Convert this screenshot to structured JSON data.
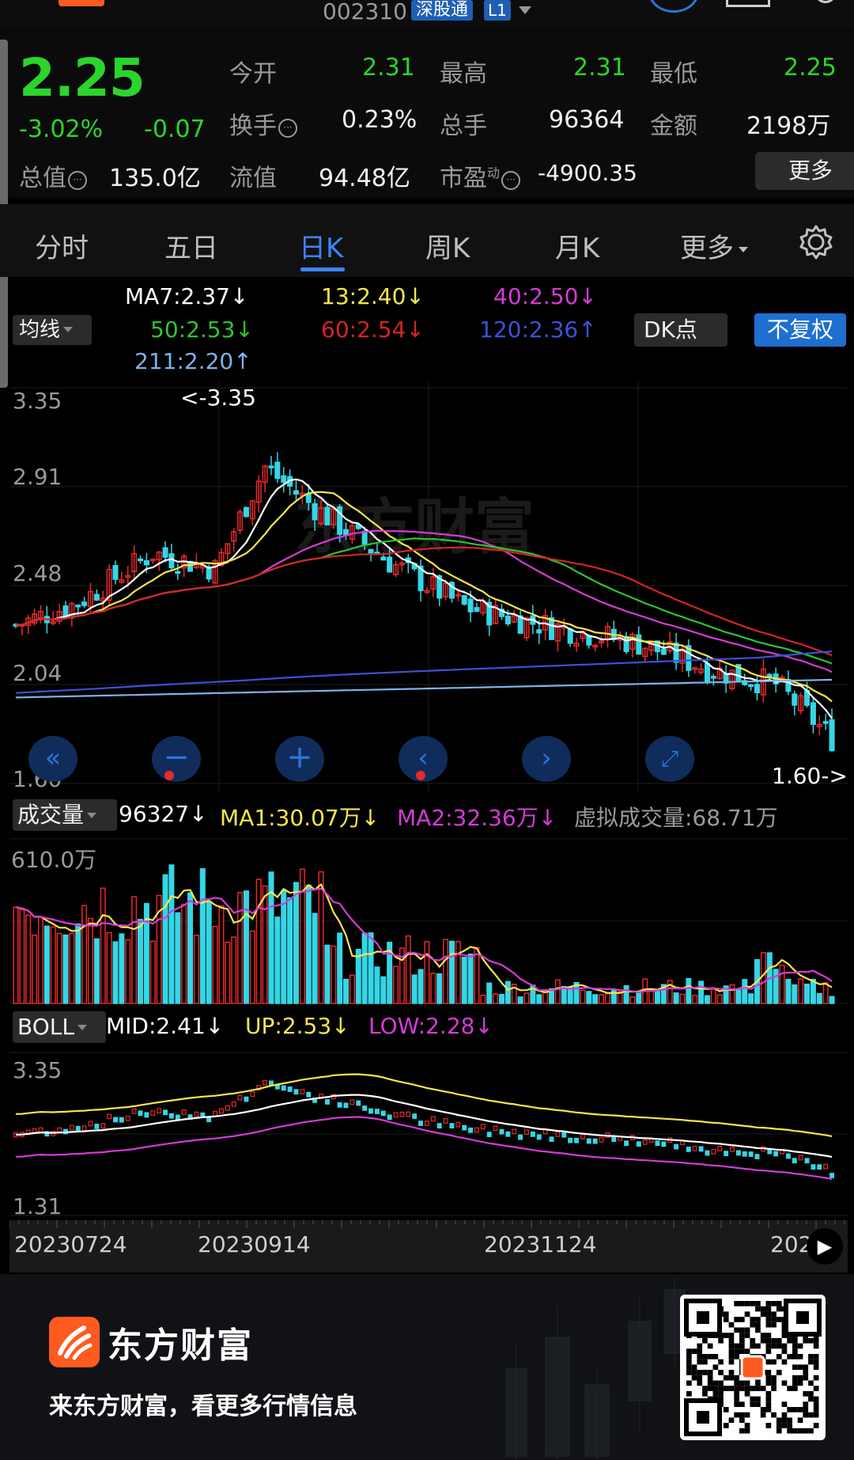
{
  "header": {
    "stock_code": "002310",
    "market_tag": "深股通",
    "level_tag": "L1"
  },
  "quote": {
    "price": "2.25",
    "change_pct": "-3.02%",
    "change_amt": "-0.07",
    "open_label": "今开",
    "open": "2.31",
    "high_label": "最高",
    "high": "2.31",
    "low_label": "最低",
    "low": "2.25",
    "turnover_label": "换手",
    "turnover": "0.23%",
    "volume_label": "总手",
    "volume": "96364",
    "amount_label": "金额",
    "amount": "2198万",
    "mktcap_label": "总值",
    "mktcap": "135.0亿",
    "float_label": "流值",
    "float": "94.48亿",
    "pe_label": "市盈",
    "pe_sup": "动",
    "pe": "-4900.35",
    "more": "更多"
  },
  "tabs": [
    {
      "label": "分时"
    },
    {
      "label": "五日"
    },
    {
      "label": "日K",
      "active": true
    },
    {
      "label": "周K"
    },
    {
      "label": "月K"
    },
    {
      "label": "更多"
    }
  ],
  "ma_legend": {
    "selector": "均线",
    "ma7": "MA7:2.37↓",
    "ma13": "13:2.40↓",
    "ma40": "40:2.50↓",
    "ma50": "50:2.53↓",
    "ma60": "60:2.54↓",
    "ma120": "120:2.36↑",
    "ma211": "211:2.20↑",
    "dk": "DK点",
    "adjust": "不复权"
  },
  "kchart": {
    "y_ticks": [
      "3.35",
      "2.91",
      "2.48",
      "2.04",
      "1.60"
    ],
    "max_note": "<-3.35",
    "min_note": "1.60->",
    "watermark": "东方财富"
  },
  "volume": {
    "selector": "成交量",
    "value": "96327↓",
    "ma1": "MA1:30.07万↓",
    "ma2": "MA2:32.36万↓",
    "virtual": "虚拟成交量:68.71万",
    "y_top": "610.0万"
  },
  "boll": {
    "selector": "BOLL",
    "mid": "MID:2.41↓",
    "up": "UP:2.53↓",
    "low": "LOW:2.28↓",
    "y_top": "3.35",
    "y_bottom": "1.31"
  },
  "dates": [
    "20230724",
    "20230914",
    "20231124",
    "202"
  ],
  "footer": {
    "brand": "东方财富",
    "slogan": "来东方财富，看更多行情信息"
  },
  "colors": {
    "up": "#e8292a",
    "down": "#34d6e6",
    "ma7": "#ffffff",
    "ma13": "#f5e64b",
    "ma40": "#d63ad6",
    "ma50": "#2fc42f",
    "ma60": "#d42424",
    "ma120": "#3a52d6",
    "ma211": "#7fb2e8"
  }
}
